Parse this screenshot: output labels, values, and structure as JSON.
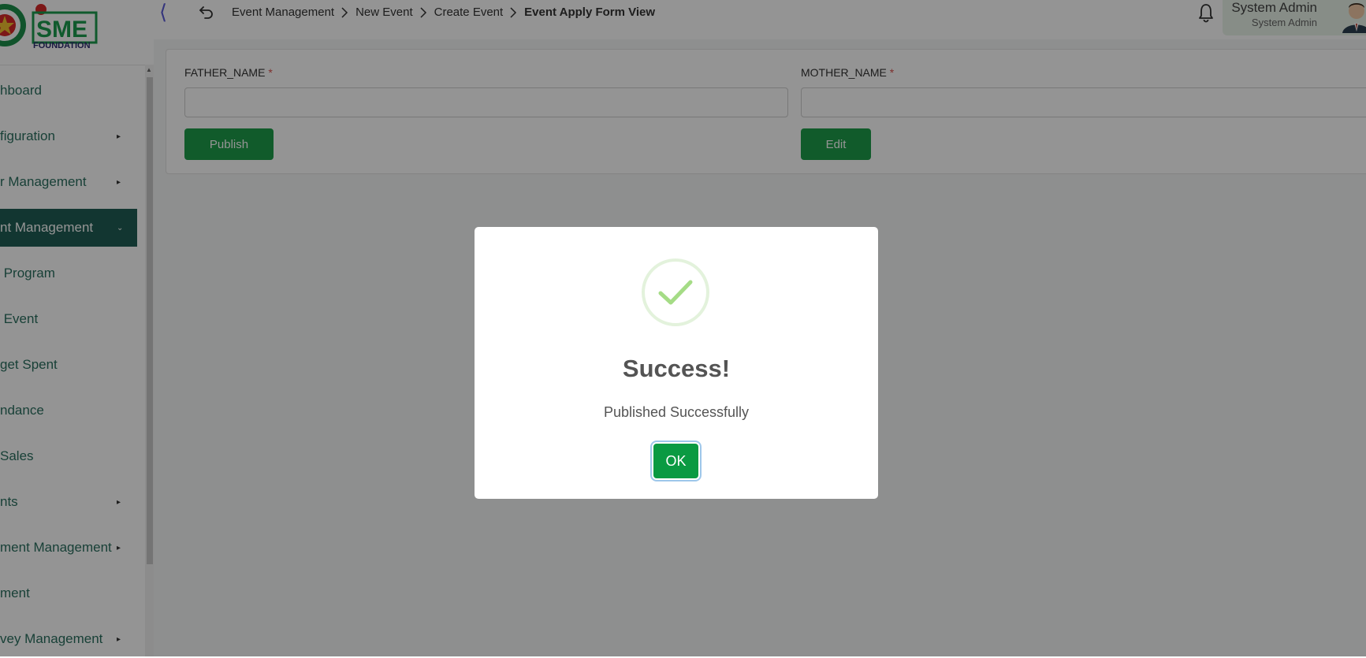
{
  "header": {
    "logo": {
      "brand": "SME",
      "subtitle": "FOUNDATION"
    },
    "collapse_icon": "chevron-left-icon",
    "back_icon": "undo-arrow-icon",
    "breadcrumb": [
      {
        "label": "Event Management"
      },
      {
        "label": "New Event"
      },
      {
        "label": "Create Event"
      },
      {
        "label": "Event Apply Form View"
      }
    ],
    "notification_icon": "bell-icon",
    "user": {
      "name": "System Admin",
      "role": "System Admin"
    }
  },
  "sidebar": {
    "items": [
      {
        "label": "hboard",
        "has_submenu": false
      },
      {
        "label": "figuration",
        "has_submenu": true
      },
      {
        "label": "r Management",
        "has_submenu": true
      },
      {
        "label": "nt Management",
        "has_submenu": true,
        "expanded": true,
        "active": true
      },
      {
        "label": " Program",
        "has_submenu": false
      },
      {
        "label": " Event",
        "has_submenu": false
      },
      {
        "label": "get Spent",
        "has_submenu": false
      },
      {
        "label": "ndance",
        "has_submenu": false
      },
      {
        "label": "Sales",
        "has_submenu": false
      },
      {
        "label": "nts",
        "has_submenu": true
      },
      {
        "label": "ment Management",
        "has_submenu": true
      },
      {
        "label": "ment",
        "has_submenu": false
      },
      {
        "label": "vey Management",
        "has_submenu": true
      }
    ]
  },
  "form": {
    "fields": [
      {
        "label": "FATHER_NAME",
        "required_mark": "*",
        "value": ""
      },
      {
        "label": "MOTHER_NAME",
        "required_mark": "*",
        "value": ""
      }
    ],
    "publish_label": "Publish",
    "edit_label": "Edit"
  },
  "modal": {
    "icon": "success-check-icon",
    "title": "Success!",
    "message": "Published Successfully",
    "ok_label": "OK"
  },
  "colors": {
    "brand_green": "#1e9e4a",
    "sidebar_active": "#1f5e55",
    "overlay": "rgba(0,0,0,0.42)",
    "ok_button": "#0a9a42"
  }
}
